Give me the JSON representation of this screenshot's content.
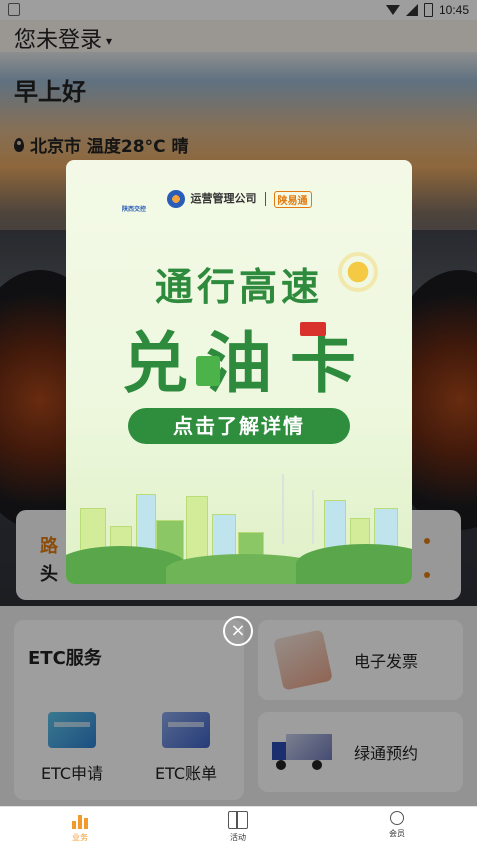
{
  "status_bar": {
    "time": "10:45"
  },
  "header": {
    "login_title": "您未登录",
    "caret": "▾"
  },
  "hero": {
    "greeting": "早上好",
    "location": "北京市 温度28°C 晴",
    "strip_text1": "路",
    "strip_text2": "头"
  },
  "services": {
    "etc_title": "ETC服务",
    "etc_apply": "ETC申请",
    "etc_bill": "ETC账单",
    "invoice": "电子发票",
    "green_pass": "绿通预约"
  },
  "tabbar": {
    "tabs": [
      {
        "label": "业务",
        "icon": "bar-chart-icon",
        "active": true
      },
      {
        "label": "活动",
        "icon": "gift-icon",
        "active": false
      },
      {
        "label": "会员",
        "icon": "member-icon",
        "active": false
      }
    ]
  },
  "popup": {
    "brand_small": "陕西交控",
    "company": "运营管理公司",
    "brand2": "陕易通",
    "headline1": "通行高速",
    "headline2": "兑油卡",
    "cta": "点击了解详情"
  },
  "close_symbol": "×",
  "colors": {
    "accent": "#f39a2c",
    "popup_green": "#2e8a3c"
  }
}
